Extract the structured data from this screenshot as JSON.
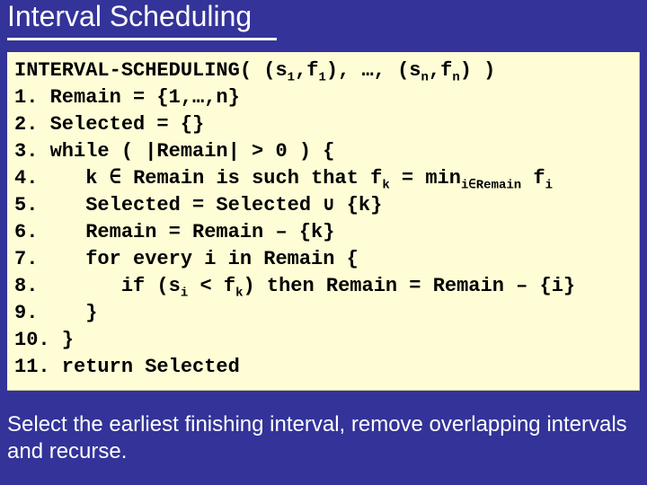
{
  "title": "Interval Scheduling",
  "code": {
    "l0_a": "INTERVAL-SCHEDULING( (s",
    "l0_s1": "1",
    "l0_b": ",f",
    "l0_s2": "1",
    "l0_c": "), …, (s",
    "l0_s3": "n",
    "l0_d": ",f",
    "l0_s4": "n",
    "l0_e": ") )",
    "l1": "1. Remain = {1,…,n}",
    "l2": "2. Selected = {}",
    "l3": "3. while ( |Remain| > 0 ) {",
    "l4_a": "4.    k ∈ Remain is such that f",
    "l4_s1": "k",
    "l4_b": " = min",
    "l4_s2": "i∈Remain",
    "l4_c": " f",
    "l4_s3": "i",
    "l5": "5.    Selected = Selected ∪ {k}",
    "l6": "6.    Remain = Remain – {k}",
    "l7": "7.    for every i in Remain {",
    "l8_a": "8.       if (s",
    "l8_s1": "i",
    "l8_b": " < f",
    "l8_s2": "k",
    "l8_c": ") then Remain = Remain – {i}",
    "l9": "9.    }",
    "l10": "10. }",
    "l11": "11. return Selected"
  },
  "caption": "Select the earliest finishing interval, remove overlapping intervals and recurse."
}
